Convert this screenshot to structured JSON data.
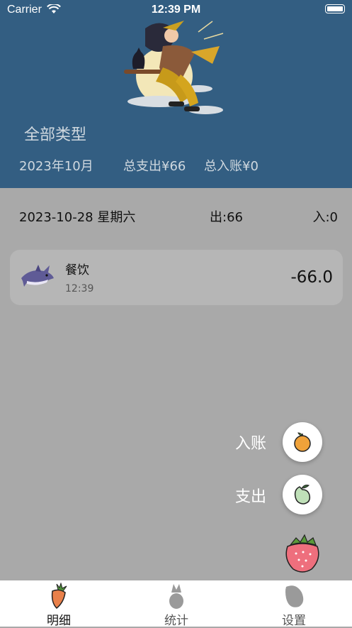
{
  "status_bar": {
    "carrier": "Carrier",
    "time": "12:39 PM"
  },
  "header": {
    "type_filter": "全部类型",
    "month": "2023年10月",
    "total_expense": "总支出¥66",
    "total_income": "总入账¥0"
  },
  "day_group": {
    "date": "2023-10-28 星期六",
    "expense": "出:66",
    "income": "入:0"
  },
  "records": [
    {
      "category": "餐饮",
      "time": "12:39",
      "amount": "-66.0",
      "icon": "shark-icon"
    }
  ],
  "fab": {
    "income_label": "入账",
    "expense_label": "支出",
    "income_icon": "orange-icon",
    "expense_icon": "pear-icon",
    "main_icon": "strawberry-icon"
  },
  "tabbar": {
    "tabs": [
      {
        "label": "明细",
        "icon": "carrot-icon",
        "active": true
      },
      {
        "label": "统计",
        "icon": "pineapple-icon",
        "active": false
      },
      {
        "label": "设置",
        "icon": "papaya-icon",
        "active": false
      }
    ]
  },
  "colors": {
    "header": "#335e82",
    "overlay": "#a9a9a9",
    "card": "#b6b6b6",
    "tab_active": "#e9804a"
  }
}
